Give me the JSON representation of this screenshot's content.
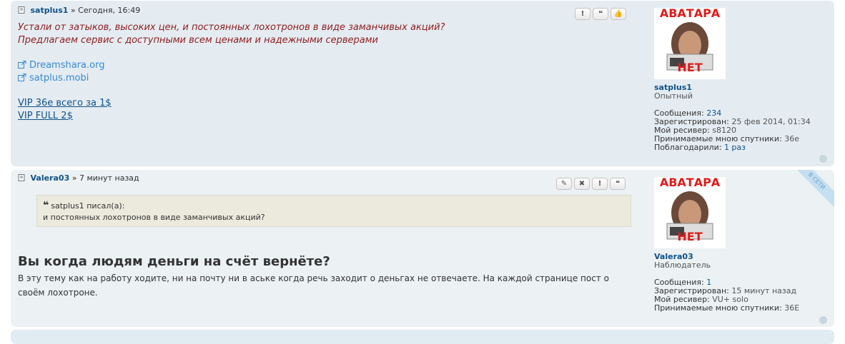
{
  "post1": {
    "author": "satplus1",
    "sep": "»",
    "time": "Сегодня, 16:49",
    "text_line1": "Устали от затыков, высоких цен, и постоянных лохотронов в виде заманчивых акций?",
    "text_line2": "Предлагаем сервис с доступными всем ценами и надежными серверами",
    "links": [
      "Dreamshara.org",
      "satplus.mobi"
    ],
    "offers": [
      "VIP 36e всего за 1$",
      "VIP FULL 2$"
    ],
    "buttons": [
      "!",
      "❝",
      "👍"
    ],
    "profile": {
      "avatar_top": "АВАТАРА",
      "avatar_bottom": "НЕТ",
      "username": "satplus1",
      "rank": "Опытный",
      "rows": [
        {
          "label": "Сообщения:",
          "value": "234"
        },
        {
          "label": "Зарегистрирован:",
          "value": "25 фев 2014, 01:34"
        },
        {
          "label": "Мой ресивер:",
          "value": "s8120"
        },
        {
          "label": "Принимаемые мною спутники:",
          "value": "36e"
        },
        {
          "label": "Поблагодарили:",
          "value": "1 раз"
        }
      ]
    }
  },
  "post2": {
    "author": "Valera03",
    "sep": "»",
    "time": "7 минут назад",
    "buttons": [
      "✎",
      "✖",
      "!",
      "❝"
    ],
    "online": "В СЕТИ",
    "quote_author": "satplus1 писал(а):",
    "quote_text": "и постоянных лохотронов в виде заманчивых акций?",
    "heading": "Вы когда людям деньги на счёт вернёте?",
    "body": "В эту тему как на работу ходите, ни на почту ни в аське когда речь заходит о деньгах не отвечаете. На каждой странице пост о своём лохотроне.",
    "profile": {
      "avatar_top": "АВАТАРА",
      "avatar_bottom": "НЕТ",
      "username": "Valera03",
      "rank": "Наблюдатель",
      "rows": [
        {
          "label": "Сообщения:",
          "value": "1"
        },
        {
          "label": "Зарегистрирован:",
          "value": "15 минут назад"
        },
        {
          "label": "Мой ресивер:",
          "value": "VU+ solo"
        },
        {
          "label": "Принимаемые мною спутники:",
          "value": "36E"
        }
      ]
    }
  }
}
